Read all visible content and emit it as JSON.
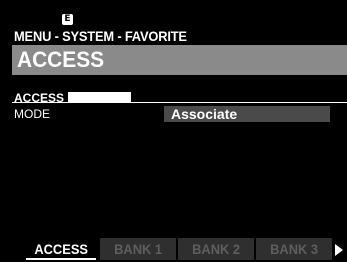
{
  "badge": {
    "letter": "E",
    "icon": "edit-badge-icon"
  },
  "breadcrumb": "MENU - SYSTEM - FAVORITE",
  "page_title": "ACCESS",
  "section": {
    "label": "ACCESS"
  },
  "params": [
    {
      "label": "MODE",
      "value": "Associate"
    }
  ],
  "tabs": [
    {
      "label": "ACCESS",
      "active": true
    },
    {
      "label": "BANK 1",
      "active": false
    },
    {
      "label": "BANK 2",
      "active": false
    },
    {
      "label": "BANK 3",
      "active": false
    }
  ],
  "next_page_icon": "next-page-arrow-icon",
  "colors": {
    "background": "#000000",
    "title_bar": "#8a8a8a",
    "value_field": "#4a4a4a",
    "inactive_tab": "#2f2f2f",
    "inactive_tab_text": "#5e5e5e",
    "text": "#ffffff"
  }
}
